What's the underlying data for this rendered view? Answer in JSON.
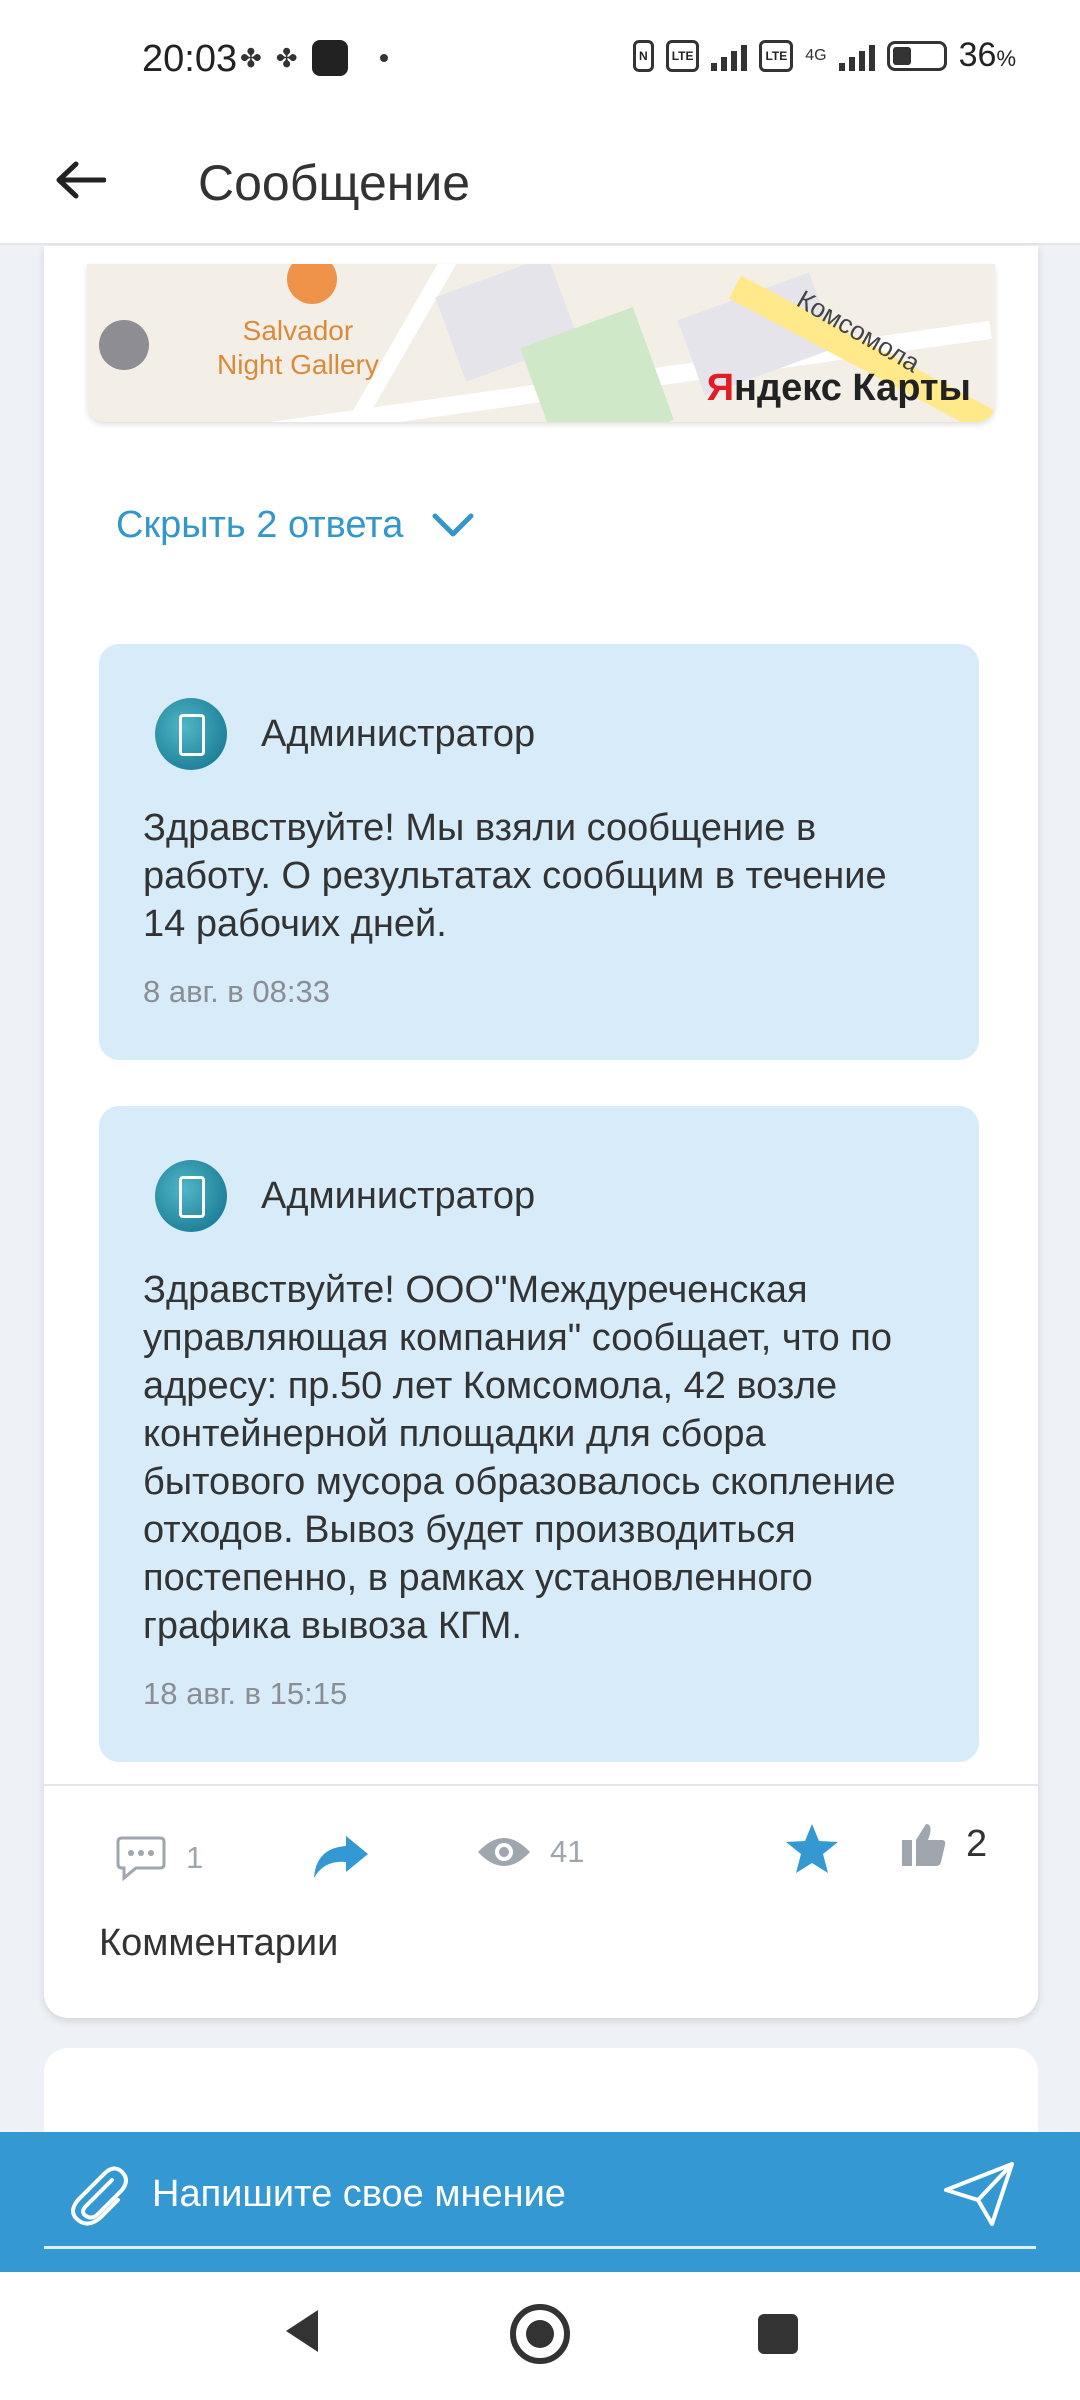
{
  "status_bar": {
    "time": "20:03",
    "network": "4G",
    "battery_percent": "36",
    "battery_unit": "%"
  },
  "header": {
    "title": "Сообщение"
  },
  "map": {
    "poi_name_line1": "Salvador",
    "poi_name_line2": "Night Gallery",
    "street": "Комсомола",
    "brand_red": "Я",
    "brand_rest": "ндекс Карты"
  },
  "replies_toggle": {
    "label": "Скрыть 2 ответа"
  },
  "replies": [
    {
      "author": "Администратор",
      "text": "Здравствуйте! Мы взяли сообщение в работу. О результатах сообщим в течение 14 рабочих дней.",
      "date": "8 авг. в 08:33"
    },
    {
      "author": "Администратор",
      "text": "Здравствуйте! ООО\"Междуреченская управляющая компания\" сообщает, что по адресу: пр.50 лет Комсомола, 42 возле контейнерной площадки для сбора бытового мусора образовалось скопление отходов. Вывоз будет производиться постепенно, в рамках установленного графика вывоза КГМ.",
      "date": "18 авг. в 15:15"
    }
  ],
  "actions": {
    "comments_count": "1",
    "views_count": "41",
    "likes_count": "2"
  },
  "comments": {
    "title": "Комментарии"
  },
  "composer": {
    "placeholder": "Напишите свое мнение"
  },
  "colors": {
    "accent": "#3498d2",
    "reply_bg": "#d7ebf8",
    "link": "#3397c9"
  }
}
